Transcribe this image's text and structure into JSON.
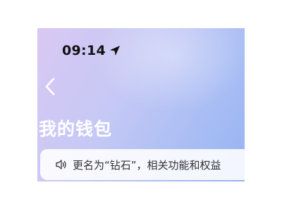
{
  "status_bar": {
    "time": "09:14",
    "location_icon": "location-arrow-icon"
  },
  "nav": {
    "back_icon": "chevron-left-icon"
  },
  "header": {
    "title": "我的钱包"
  },
  "notice": {
    "icon": "speaker-icon",
    "text": "更名为“钻石”，相关功能和权益"
  },
  "colors": {
    "gradient_start": "#d9c7f3",
    "gradient_end": "#97b3f2",
    "title_text": "#ffffff",
    "notice_bg": "#ffffff"
  }
}
